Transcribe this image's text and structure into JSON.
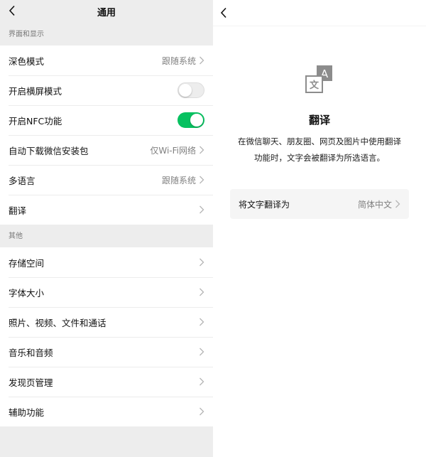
{
  "left": {
    "title": "通用",
    "sections": [
      {
        "header": "界面和显示",
        "rows": [
          {
            "label": "深色模式",
            "value": "跟随系统",
            "kind": "chevron"
          },
          {
            "label": "开启横屏模式",
            "kind": "toggle",
            "on": false
          },
          {
            "label": "开启NFC功能",
            "kind": "toggle",
            "on": true
          },
          {
            "label": "自动下载微信安装包",
            "value": "仅Wi-Fi网络",
            "kind": "chevron"
          },
          {
            "label": "多语言",
            "value": "跟随系统",
            "kind": "chevron"
          },
          {
            "label": "翻译",
            "value": "",
            "kind": "chevron"
          }
        ]
      },
      {
        "header": "其他",
        "rows": [
          {
            "label": "存储空间",
            "value": "",
            "kind": "chevron"
          },
          {
            "label": "字体大小",
            "value": "",
            "kind": "chevron"
          },
          {
            "label": "照片、视频、文件和通话",
            "value": "",
            "kind": "chevron"
          },
          {
            "label": "音乐和音频",
            "value": "",
            "kind": "chevron"
          },
          {
            "label": "发现页管理",
            "value": "",
            "kind": "chevron"
          },
          {
            "label": "辅助功能",
            "value": "",
            "kind": "chevron"
          }
        ]
      }
    ]
  },
  "right": {
    "icon": "translate-icon",
    "icon_glyph_back": "A",
    "icon_glyph_front": "文",
    "title": "翻译",
    "description_line1": "在微信聊天、朋友圈、网页及图片中使用翻译",
    "description_line2": "功能时，文字会被翻译为所选语言。",
    "setting_label": "将文字翻译为",
    "setting_value": "简体中文"
  },
  "colors": {
    "accent_green": "#07c160",
    "page_bg": "#ededed",
    "secondary_text": "#808080"
  }
}
